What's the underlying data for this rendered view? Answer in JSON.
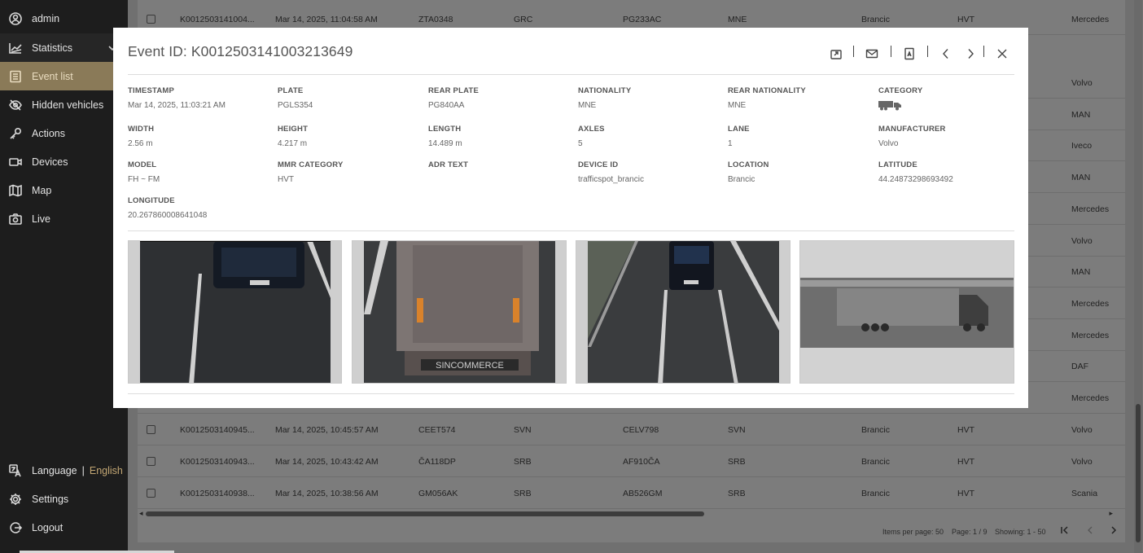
{
  "sidebar": {
    "user": "admin",
    "items": [
      {
        "label": "Statistics",
        "icon": "chart-icon"
      },
      {
        "label": "Event list",
        "icon": "list-icon"
      },
      {
        "label": "Hidden vehicles",
        "icon": "eye-off-icon"
      },
      {
        "label": "Actions",
        "icon": "key-icon"
      },
      {
        "label": "Devices",
        "icon": "camera-icon"
      },
      {
        "label": "Map",
        "icon": "map-icon"
      },
      {
        "label": "Live",
        "icon": "photo-camera-icon"
      }
    ],
    "language_label": "Language",
    "language_sep": "|",
    "language_value": "English",
    "settings": "Settings",
    "logout": "Logout"
  },
  "table": {
    "rows": [
      {
        "id": "K0012503141004...",
        "time": "Mar 14, 2025, 11:04:58 AM",
        "plate": "ZTA0348",
        "nat": "GRC",
        "rear": "PG233AC",
        "rnat": "MNE",
        "loc": "Brancic",
        "cat": "HVT",
        "make": "Mercedes"
      },
      {
        "id": "K0012503140945...",
        "time": "Mar 14, 2025, 10:45:57 AM",
        "plate": "CEET574",
        "nat": "SVN",
        "rear": "CELV798",
        "rnat": "SVN",
        "loc": "Brancic",
        "cat": "HVT",
        "make": "Volvo"
      },
      {
        "id": "K0012503140943...",
        "time": "Mar 14, 2025, 10:43:42 AM",
        "plate": "ČA118DP",
        "nat": "SRB",
        "rear": "AF910ČA",
        "rnat": "SRB",
        "loc": "Brancic",
        "cat": "HVT",
        "make": "Volvo"
      },
      {
        "id": "K0012503140938...",
        "time": "Mar 14, 2025, 10:38:56 AM",
        "plate": "GM056AK",
        "nat": "SRB",
        "rear": "AB526GM",
        "rnat": "SRB",
        "loc": "Brancic",
        "cat": "HVT",
        "make": "Scania"
      }
    ],
    "side_makes": [
      "Volvo",
      "MAN",
      "Iveco",
      "MAN",
      "Mercedes",
      "Volvo",
      "MAN",
      "Mercedes",
      "Mercedes",
      "DAF",
      "Mercedes"
    ],
    "footer": {
      "items_per_page": "Items per page: 50",
      "page": "Page: 1 / 9",
      "showing": "Showing: 1 - 50"
    }
  },
  "modal": {
    "title": "Event ID: K0012503141003213649",
    "tools": [
      "export-icon",
      "mail-icon",
      "pdf-icon",
      "prev-icon",
      "next-icon",
      "close-icon"
    ],
    "fields": {
      "timestamp": {
        "label": "TIMESTAMP",
        "value": "Mar 14, 2025, 11:03:21 AM"
      },
      "plate": {
        "label": "PLATE",
        "value": "PGLS354"
      },
      "rear_plate": {
        "label": "REAR PLATE",
        "value": "PG840AA"
      },
      "nationality": {
        "label": "NATIONALITY",
        "value": "MNE"
      },
      "rear_nationality": {
        "label": "REAR NATIONALITY",
        "value": "MNE"
      },
      "category": {
        "label": "CATEGORY",
        "icon": "truck-icon"
      },
      "width": {
        "label": "WIDTH",
        "value": "2.56 m"
      },
      "height": {
        "label": "HEIGHT",
        "value": "4.217 m"
      },
      "length": {
        "label": "LENGTH",
        "value": "14.489 m"
      },
      "axles": {
        "label": "AXLES",
        "value": "5"
      },
      "lane": {
        "label": "LANE",
        "value": "1"
      },
      "manufacturer": {
        "label": "MANUFACTURER",
        "value": "Volvo"
      },
      "model": {
        "label": "MODEL",
        "value": "FH ~ FM"
      },
      "mmr_category": {
        "label": "MMR CATEGORY",
        "value": "HVT"
      },
      "adr_text": {
        "label": "ADR TEXT",
        "value": ""
      },
      "device_id": {
        "label": "DEVICE ID",
        "value": "trafficspot_brancic"
      },
      "location": {
        "label": "LOCATION",
        "value": "Brancic"
      },
      "latitude": {
        "label": "LATITUDE",
        "value": "44.24873298693492"
      },
      "longitude": {
        "label": "LONGITUDE",
        "value": "20.267860008641048"
      }
    },
    "photos": [
      "front-camera-photo",
      "rear-camera-photo",
      "overview-camera-photo",
      "side-profile-photo"
    ],
    "rear_trailer_text": "SINCOMMERCE"
  }
}
